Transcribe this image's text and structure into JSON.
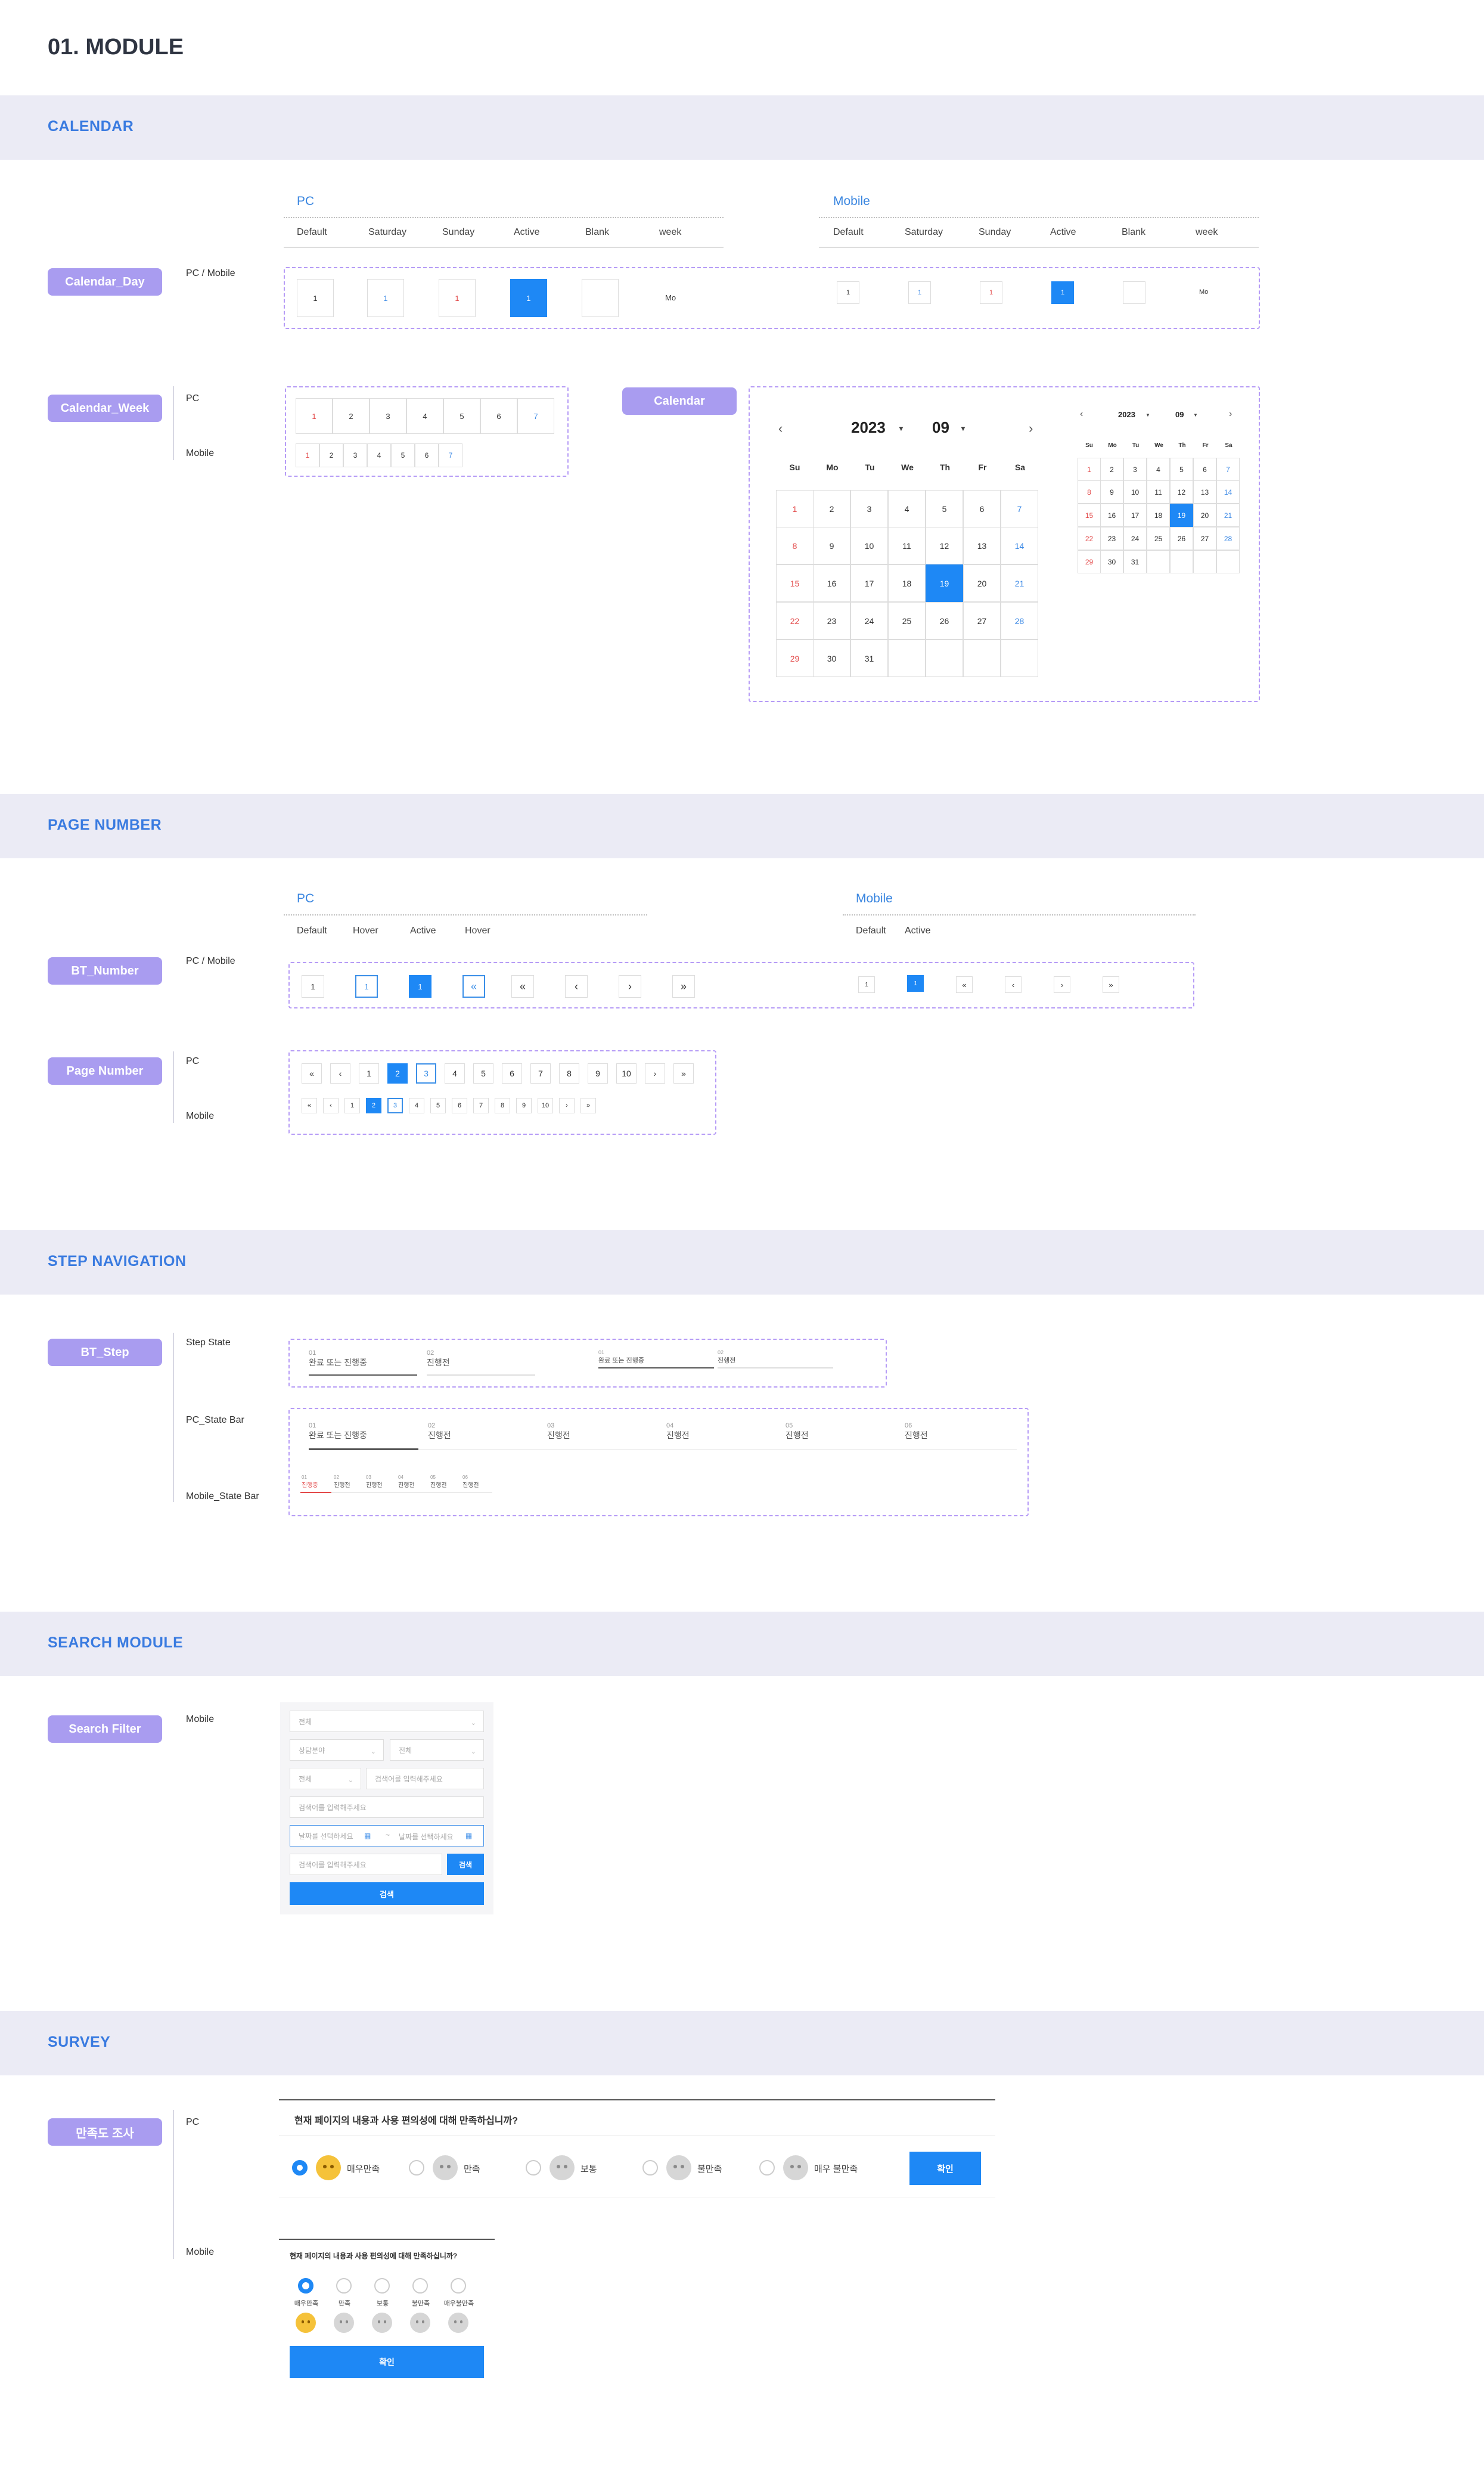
{
  "page_title": "01. MODULE",
  "sections": {
    "calendar": "CALENDAR",
    "page_number": "PAGE NUMBER",
    "step_navigation": "STEP NAVIGATION",
    "search_module": "SEARCH MODULE",
    "survey": "SURVEY"
  },
  "calendar_day": {
    "label": "Calendar_Day",
    "side": "PC / Mobile",
    "pc_title": "PC",
    "mobile_title": "Mobile",
    "columns": [
      "Default",
      "Saturday",
      "Sunday",
      "Active",
      "Blank",
      "week"
    ],
    "cell_value": "1",
    "week_value": "Mo"
  },
  "calendar_week": {
    "label": "Calendar_Week",
    "pc_label": "PC",
    "mobile_label": "Mobile",
    "days": [
      "1",
      "2",
      "3",
      "4",
      "5",
      "6",
      "7"
    ]
  },
  "calendar": {
    "label": "Calendar",
    "year": "2023",
    "month": "09",
    "weekdays": [
      "Su",
      "Mo",
      "Tu",
      "We",
      "Th",
      "Fr",
      "Sa"
    ],
    "weeks": [
      [
        "1",
        "2",
        "3",
        "4",
        "5",
        "6",
        "7"
      ],
      [
        "8",
        "9",
        "10",
        "11",
        "12",
        "13",
        "14"
      ],
      [
        "15",
        "16",
        "17",
        "18",
        "19",
        "20",
        "21"
      ],
      [
        "22",
        "23",
        "24",
        "25",
        "26",
        "27",
        "28"
      ],
      [
        "29",
        "30",
        "31",
        "",
        "",
        "",
        ""
      ]
    ],
    "active_day": "19",
    "red_days": [
      "1",
      "8",
      "15",
      "22",
      "29"
    ],
    "blue_days": [
      "7",
      "14",
      "21",
      "28"
    ]
  },
  "bt_number": {
    "label": "BT_Number",
    "side": "PC / Mobile",
    "pc_title": "PC",
    "mobile_title": "Mobile",
    "pc_columns": [
      "Default",
      "Hover",
      "Active",
      "Hover"
    ],
    "mobile_columns": [
      "Default",
      "Active"
    ],
    "value": "1"
  },
  "page_number": {
    "label": "Page Number",
    "pc_label": "PC",
    "mobile_label": "Mobile",
    "pages": [
      "1",
      "2",
      "3",
      "4",
      "5",
      "6",
      "7",
      "8",
      "9",
      "10"
    ]
  },
  "bt_step": {
    "label": "BT_Step",
    "state_label": "Step State",
    "pc_bar_label": "PC_State Bar",
    "mobile_bar_label": "Mobile_State Bar",
    "done_text": "완료 또는 진행중",
    "pending_text": "진행전",
    "current_mobile": "진행중",
    "numbers": [
      "01",
      "02",
      "03",
      "04",
      "05",
      "06"
    ]
  },
  "search_filter": {
    "label": "Search Filter",
    "side": "Mobile",
    "select_all": "전체",
    "select_category": "상담분야",
    "placeholder_keyword": "검색어를 입력해주세요",
    "placeholder_date": "날짜를 선택하세요",
    "date_sep": "~",
    "search_button": "검색"
  },
  "survey": {
    "label": "만족도 조사",
    "pc_label": "PC",
    "mobile_label": "Mobile",
    "question": "현재 페이지의 내용과 사용 편의성에 대해 만족하십니까?",
    "options": [
      "매우만족",
      "만족",
      "보통",
      "불만족",
      "매우 불만족"
    ],
    "mobile_options": [
      "매우만족",
      "만족",
      "보통",
      "불만족",
      "매우불만족"
    ],
    "confirm": "확인"
  },
  "colors": {
    "accent": "#1e88f5",
    "pill": "#a99cf0",
    "section_band": "#ebebf5",
    "section_title": "#3a7be0",
    "saturday": "#3d8ae6",
    "sunday": "#e34b4b",
    "dashed_border": "#b69cf6"
  }
}
